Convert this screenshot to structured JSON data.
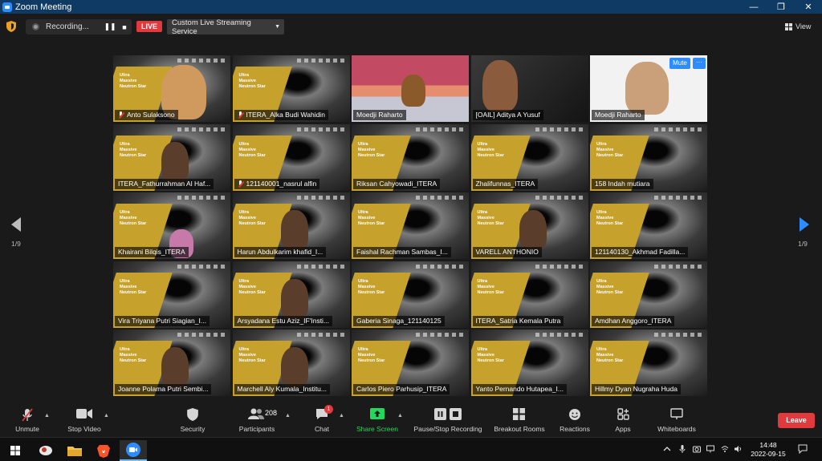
{
  "window": {
    "title": "Zoom Meeting",
    "minimize": "—",
    "maximize": "❐",
    "close": "✕"
  },
  "topbar": {
    "recording_label": "Recording...",
    "pause_glyph": "❚❚",
    "stop_glyph": "■",
    "live_badge": "LIVE",
    "stream_service": "Custom Live Streaming Service",
    "view_label": "View"
  },
  "slide": {
    "line1": "Ultra",
    "line2": "Massive",
    "line3": "Neutron Star"
  },
  "tiles": [
    {
      "name": "Anto Sulaksono",
      "kind": "presenter",
      "muted": true,
      "active": true
    },
    {
      "name": "ITERA_Alka Budi Wahidin",
      "kind": "slide",
      "muted": true
    },
    {
      "name": "Moedji Raharto",
      "kind": "banner",
      "muted": false
    },
    {
      "name": "[OAIL] Aditya A Yusuf",
      "kind": "webcam",
      "muted": false
    },
    {
      "name": "Moedji Raharto",
      "kind": "white",
      "muted": false
    },
    {
      "name": "ITERA_Fathurrahman Al Haf...",
      "kind": "slide-person",
      "muted": false
    },
    {
      "name": "121140001_nasrul alfin",
      "kind": "slide",
      "muted": true
    },
    {
      "name": "Riksan Cahyowadi_ITERA",
      "kind": "slide",
      "muted": false
    },
    {
      "name": "Zhalifunnas_ITERA",
      "kind": "slide",
      "muted": false
    },
    {
      "name": "158 Indah mutiara",
      "kind": "slide",
      "muted": false
    },
    {
      "name": "Khairani Bilqis_ITERA",
      "kind": "slide-mirror",
      "muted": false
    },
    {
      "name": "Harun Abdulkarim khafid_I...",
      "kind": "slide-person",
      "muted": false
    },
    {
      "name": "Faishal Rachman Sambas_I...",
      "kind": "slide",
      "muted": false
    },
    {
      "name": "VARELL ANTHONIO",
      "kind": "slide-person",
      "muted": false
    },
    {
      "name": "121140130_Akhmad Fadilla...",
      "kind": "slide",
      "muted": false
    },
    {
      "name": "Vira Triyana Putri Siagian_I...",
      "kind": "slide",
      "muted": false
    },
    {
      "name": "Arsyadana Estu Aziz_IF'Insti...",
      "kind": "slide-person",
      "muted": false
    },
    {
      "name": "Gaberia Sinaga_121140125",
      "kind": "slide",
      "muted": false
    },
    {
      "name": "ITERA_Satria Kemala Putra",
      "kind": "slide",
      "muted": false
    },
    {
      "name": "Amdhan Anggoro_ITERA",
      "kind": "slide",
      "muted": false
    },
    {
      "name": "Joanne Polama Putri Sembi...",
      "kind": "slide-person",
      "muted": false
    },
    {
      "name": "Marchell Aly Kumala_Institu...",
      "kind": "slide-person",
      "muted": false
    },
    {
      "name": "Carlos Piero Parhusip_ITERA",
      "kind": "slide",
      "muted": false
    },
    {
      "name": "Yanto Pernando Hutapea_I...",
      "kind": "slide",
      "muted": false
    },
    {
      "name": "Hillmy Dyan Nugraha Huda",
      "kind": "slide",
      "muted": false
    }
  ],
  "tile_actions": {
    "mute_label": "Mute",
    "more_label": "···"
  },
  "pagination": {
    "left": "1/9",
    "right": "1/9"
  },
  "toolbar": {
    "unmute": "Unmute",
    "stop_video": "Stop Video",
    "security": "Security",
    "participants": "Participants",
    "participant_count": "208",
    "chat": "Chat",
    "chat_badge": "1",
    "share_screen": "Share Screen",
    "pause_stop_recording": "Pause/Stop Recording",
    "breakout_rooms": "Breakout Rooms",
    "reactions": "Reactions",
    "apps": "Apps",
    "whiteboards": "Whiteboards",
    "leave": "Leave"
  },
  "taskbar": {
    "time": "14:48",
    "date": "2022-09-15"
  },
  "colors": {
    "accent": "#2d8cff",
    "danger": "#e0393e",
    "share_green": "#23d959",
    "active_speaker": "#d8e05a",
    "title_bar": "#0e3a63"
  }
}
